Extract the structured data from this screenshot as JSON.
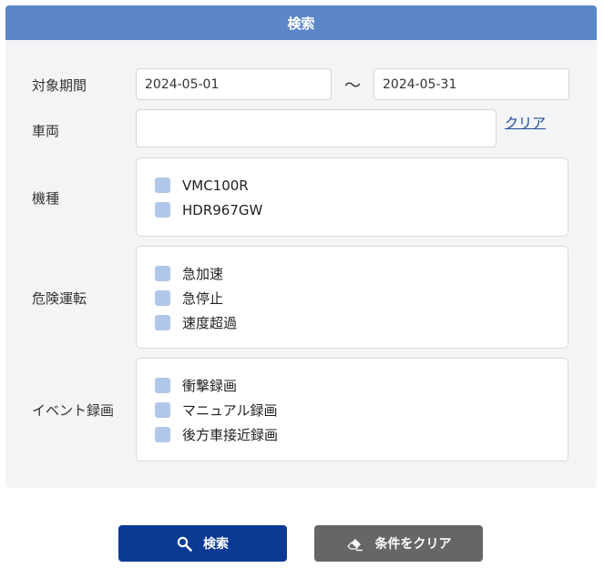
{
  "panel": {
    "title": "検索"
  },
  "period": {
    "label": "対象期間",
    "from": "2024-05-01",
    "separator": "～",
    "to": "2024-05-31"
  },
  "vehicle": {
    "label": "車両",
    "value": "",
    "clear_label": "クリア"
  },
  "model": {
    "label": "機種",
    "options": [
      {
        "label": "VMC100R",
        "checked": false
      },
      {
        "label": "HDR967GW",
        "checked": false
      }
    ]
  },
  "danger": {
    "label": "危険運転",
    "options": [
      {
        "label": "急加速",
        "checked": false
      },
      {
        "label": "急停止",
        "checked": false
      },
      {
        "label": "速度超過",
        "checked": false
      }
    ]
  },
  "event": {
    "label": "イベント録画",
    "options": [
      {
        "label": "衝撃録画",
        "checked": false
      },
      {
        "label": "マニュアル録画",
        "checked": false
      },
      {
        "label": "後方車接近録画",
        "checked": false
      }
    ]
  },
  "actions": {
    "search_label": "検索",
    "clear_label": "条件をクリア"
  },
  "icons": {
    "search": "search-icon",
    "eraser": "eraser-icon"
  },
  "colors": {
    "header": "#5b87c9",
    "search_button": "#0a3a94",
    "clear_button": "#666666",
    "checkbox": "#b1c7ea",
    "link": "#1e4a9c"
  }
}
